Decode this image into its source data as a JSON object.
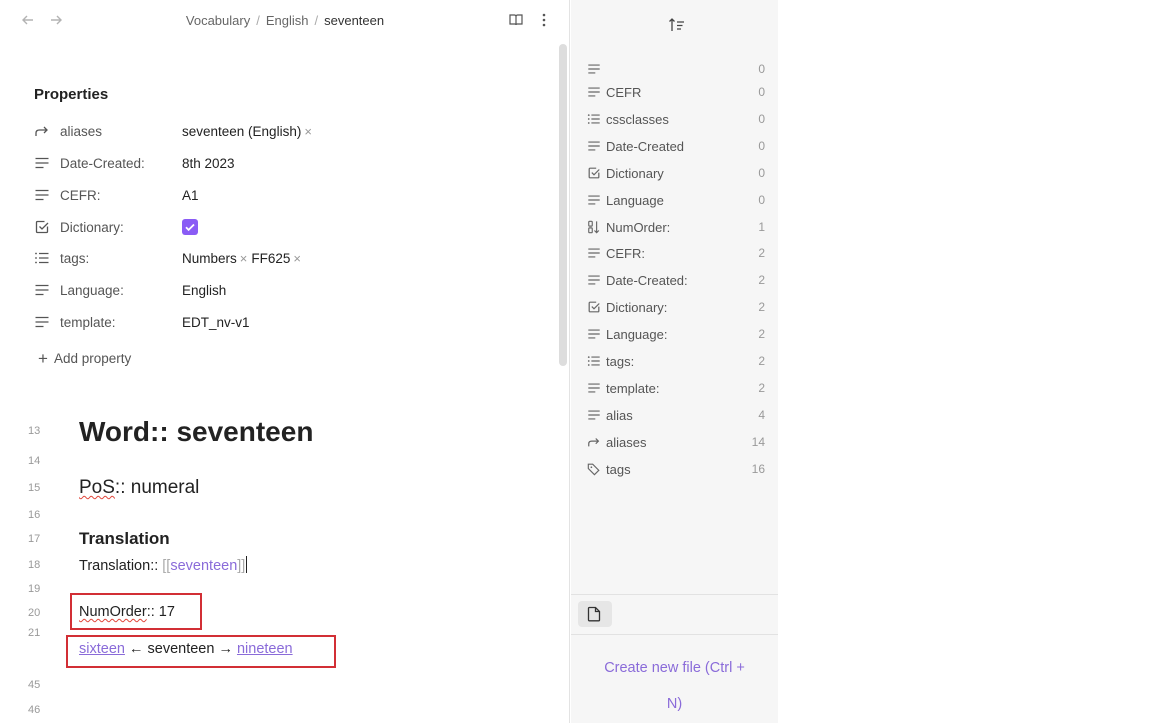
{
  "breadcrumb": {
    "parts": [
      "Vocabulary",
      "English"
    ],
    "current": "seventeen"
  },
  "icons": {
    "back": "arrow-left-icon",
    "forward": "arrow-right-icon",
    "reading": "book-icon",
    "more": "more-vertical-icon",
    "sort": "sort-icon",
    "new_file": "file-icon"
  },
  "properties": {
    "title": "Properties",
    "items": [
      {
        "key": "aliases",
        "icon": "link-arrow-icon",
        "values": [
          "seventeen (English)"
        ]
      },
      {
        "key": "Date-Created:",
        "icon": "text-icon",
        "value": "8th 2023"
      },
      {
        "key": "CEFR:",
        "icon": "text-icon",
        "value": "A1"
      },
      {
        "key": "Dictionary:",
        "icon": "checkbox-icon",
        "checked": true
      },
      {
        "key": "tags:",
        "icon": "list-icon",
        "values": [
          "Numbers",
          "FF625"
        ]
      },
      {
        "key": "Language:",
        "icon": "text-icon",
        "value": "English"
      },
      {
        "key": "template:",
        "icon": "text-icon",
        "value": "EDT_nv-v1"
      }
    ],
    "add_label": "Add property",
    "remove_glyph": "×"
  },
  "editor": {
    "line_numbers": [
      "13",
      "14",
      "15",
      "16",
      "17",
      "18",
      "19",
      "20",
      "21",
      "45",
      "46"
    ],
    "word_heading": "Word:: seventeen",
    "pos_key": "PoS",
    "pos_rest": ":: numeral",
    "translation_heading": "Translation",
    "translation_key": "Translation:: ",
    "bracket_open": "[[",
    "translation_link": "seventeen",
    "bracket_close": "]]",
    "numorder_key": "NumOrder",
    "numorder_rest": ":: 17",
    "nav_prev": "sixteen",
    "nav_middle": " ← seventeen → ",
    "nav_next": "nineteen"
  },
  "sidebar": {
    "items": [
      {
        "name": "",
        "icon": "text-icon",
        "count": "0"
      },
      {
        "name": "CEFR",
        "icon": "text-icon",
        "count": "0"
      },
      {
        "name": "cssclasses",
        "icon": "list-icon",
        "count": "0"
      },
      {
        "name": "Date-Created",
        "icon": "text-icon",
        "count": "0"
      },
      {
        "name": "Dictionary",
        "icon": "checkbox-icon",
        "count": "0"
      },
      {
        "name": "Language",
        "icon": "text-icon",
        "count": "0"
      },
      {
        "name": "NumOrder:",
        "icon": "number-icon",
        "count": "1"
      },
      {
        "name": "CEFR:",
        "icon": "text-icon",
        "count": "2"
      },
      {
        "name": "Date-Created:",
        "icon": "text-icon",
        "count": "2"
      },
      {
        "name": "Dictionary:",
        "icon": "checkbox-icon",
        "count": "2"
      },
      {
        "name": "Language:",
        "icon": "text-icon",
        "count": "2"
      },
      {
        "name": "tags:",
        "icon": "list-icon",
        "count": "2"
      },
      {
        "name": "template:",
        "icon": "text-icon",
        "count": "2"
      },
      {
        "name": "alias",
        "icon": "text-icon",
        "count": "4"
      },
      {
        "name": "aliases",
        "icon": "link-arrow-icon",
        "count": "14"
      },
      {
        "name": "tags",
        "icon": "tag-icon",
        "count": "16"
      }
    ],
    "create_new_line1": "Create new file (Ctrl +",
    "create_new_line2": "N)"
  },
  "colors": {
    "accent": "#8a6bd9",
    "checkbox": "#8a5cf5",
    "highlight_box": "#d22f35",
    "sidebar_bg": "#f6f6f6"
  }
}
